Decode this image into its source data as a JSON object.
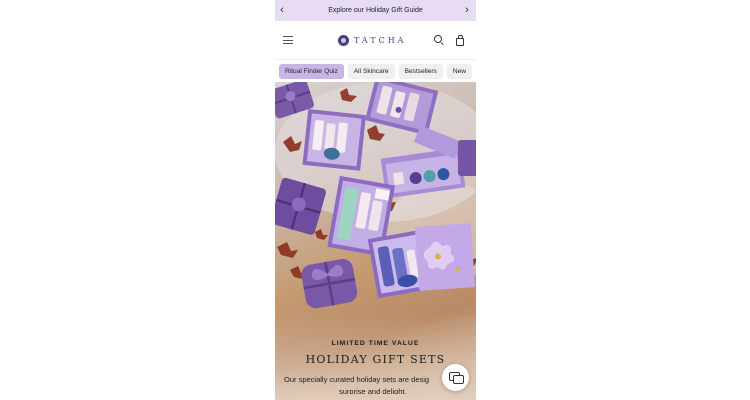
{
  "promo_bar": {
    "text": "Explore our Holiday Gift Guide",
    "prev_icon": "chevron-left-icon",
    "next_icon": "chevron-right-icon"
  },
  "header": {
    "logo_text": "TATCHA",
    "menu_icon": "hamburger-menu-icon",
    "search_icon": "search-icon",
    "bag_icon": "shopping-bag-icon"
  },
  "chips": [
    {
      "label": "Ritual Finder Quiz",
      "active": true
    },
    {
      "label": "All Skincare",
      "active": false
    },
    {
      "label": "Bestsellers",
      "active": false
    },
    {
      "label": "New",
      "active": false
    }
  ],
  "hero": {
    "eyebrow": "LIMITED TIME VALUE",
    "title": "HOLIDAY GIFT SETS",
    "description_line1": "Our specially curated holiday sets are desig",
    "description_line2": "surprise and delight."
  },
  "chat": {
    "icon": "chat-bubbles-icon"
  },
  "colors": {
    "promo_bg": "#e7dcf4",
    "brand": "#4b3c7a",
    "chip_active": "#c7b5e6",
    "gift_box": "#8e6fc4"
  }
}
